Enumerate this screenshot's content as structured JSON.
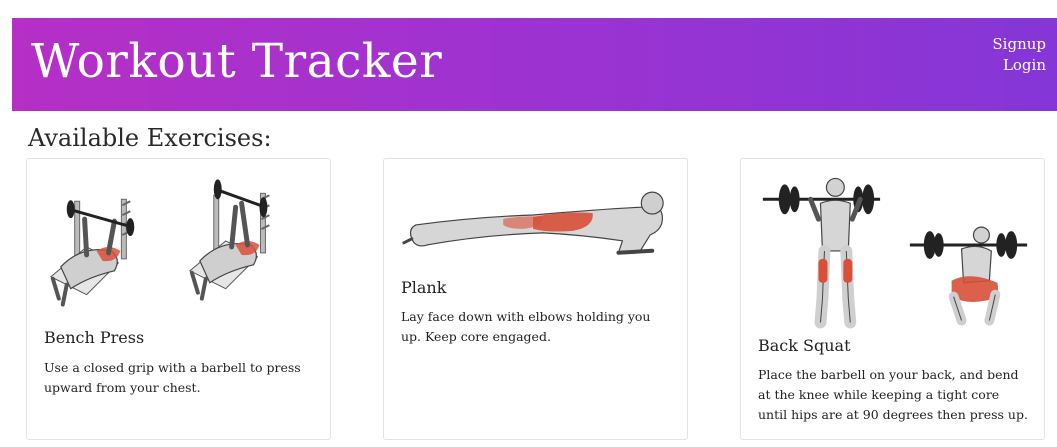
{
  "header": {
    "brand": "Workout Tracker",
    "nav": {
      "signup": "Signup",
      "login": "Login"
    },
    "gradient_colors": [
      "#b62fc6",
      "#8536d6"
    ]
  },
  "main": {
    "section_title": "Available Exercises:",
    "exercises": [
      {
        "name": "Bench Press",
        "description": "Use a closed grip with a barbell to press upward from your chest.",
        "image": "bench-press-illustration"
      },
      {
        "name": "Plank",
        "description": "Lay face down with elbows holding you up. Keep core engaged.",
        "image": "plank-illustration"
      },
      {
        "name": "Back Squat",
        "description": "Place the barbell on your back, and bend at the knee while keeping a tight core until hips are at 90 degrees then press up.",
        "image": "back-squat-illustration"
      }
    ]
  },
  "colors": {
    "muscle_highlight": "#d8503a",
    "skin": "#d9d9d9",
    "outline": "#444444"
  }
}
